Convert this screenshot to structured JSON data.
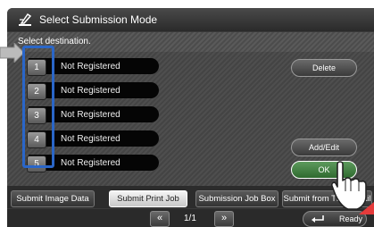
{
  "header": {
    "title": "Select Submission Mode"
  },
  "instruction": "Select destination.",
  "rows": [
    {
      "number": "1",
      "label": "Not Registered"
    },
    {
      "number": "2",
      "label": "Not Registered"
    },
    {
      "number": "3",
      "label": "Not Registered"
    },
    {
      "number": "4",
      "label": "Not Registered"
    },
    {
      "number": "5",
      "label": "Not Registered"
    }
  ],
  "side_buttons": {
    "delete": "Delete",
    "add_edit": "Add/Edit",
    "ok": "OK"
  },
  "tabs": [
    {
      "label": "Submit Image Data",
      "active": false
    },
    {
      "label": "Submit Print Job",
      "active": true
    },
    {
      "label": "Submission Job Box",
      "active": false
    },
    {
      "label": "Submit from Thumbnail",
      "active": false
    }
  ],
  "pager": {
    "prev": "«",
    "page": "1/1",
    "next": "»"
  },
  "status": {
    "ready_label": "Ready"
  },
  "colors": {
    "callout": "#2a66c8",
    "ok_green": "#3f7f3f"
  }
}
